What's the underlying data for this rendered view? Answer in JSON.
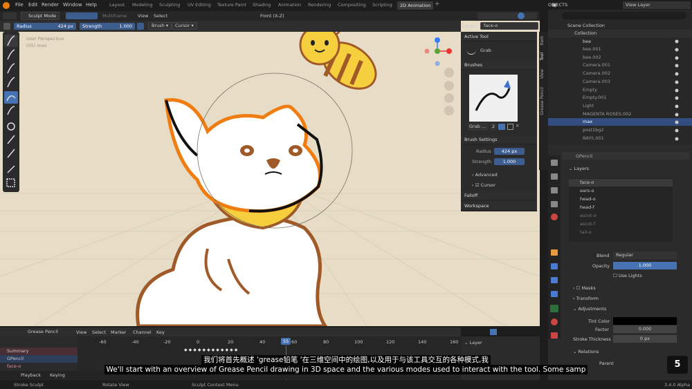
{
  "topbar": {
    "menus": [
      "File",
      "Edit",
      "Render",
      "Window",
      "Help"
    ],
    "mode": "Sculpt Mode",
    "multiframe": "Multiframe",
    "view": "View",
    "select": "Select",
    "workspaces": [
      "Layout",
      "Modeling",
      "Sculpting",
      "UV Editing",
      "Texture Paint",
      "Shading",
      "Animation",
      "Rendering",
      "Compositing",
      "Scripting",
      "2D Animation"
    ],
    "active_workspace": "2D Animation",
    "plus": "+"
  },
  "viewport_header": {
    "orientation": "Front (X-Z)",
    "layer_label": "Layer:",
    "layer_value": "face-o"
  },
  "toolsettings": {
    "radius_label": "Radius",
    "radius_value": "424 px",
    "strength_label": "Strength",
    "strength_value": "1.000",
    "brush": "Brush",
    "cursor": "Cursor"
  },
  "viewport": {
    "line1": "User Perspective",
    "line2": "(55) max"
  },
  "npanel": {
    "active_tool": "Active Tool",
    "tool_name": "Grab",
    "brushes": "Brushes",
    "brush_name": "Grab ...",
    "brush_users": "2",
    "brush_settings": "Brush Settings",
    "radius_label": "Radius",
    "radius_value": "424 px",
    "strength_label": "Strength",
    "strength_value": "1.000",
    "advanced": "Advanced",
    "cursor": "Cursor",
    "falloff": "Falloff",
    "workspace": "Workspace"
  },
  "vtabs": [
    "Item",
    "Tool",
    "View",
    "Grease Pencil"
  ],
  "outliner": {
    "editor": "OBJECTS",
    "view_layer": "View Layer",
    "scene_collection": "Scene Collection",
    "collection": "Collection",
    "rows": [
      "bee",
      "bee.001",
      "bee.002",
      "Camera.001",
      "Camera.002",
      "Camera.003",
      "Empty",
      "Empty.001",
      "Light",
      "MAGENTA ROSES.002",
      "max",
      "post1bg2",
      "RAYS.001"
    ]
  },
  "props": {
    "object": "GPencil",
    "layers_title": "Layers",
    "layers": [
      "face-o",
      "ears-o",
      "head-o",
      "head-f",
      "ascot-o",
      "ascot-f",
      "tail-o"
    ],
    "blend_label": "Blend",
    "blend_value": "Regular",
    "opacity_label": "Opacity",
    "opacity_value": "1.000",
    "use_lights": "Use Lights",
    "masks": "Masks",
    "transform": "Transform",
    "adjustments": "Adjustments",
    "tint_label": "Tint Color",
    "factor_label": "Factor",
    "factor_value": "0.000",
    "stroke_label": "Stroke Thickness",
    "stroke_value": "0 px",
    "relations": "Relations",
    "parent_label": "Parent"
  },
  "timeline": {
    "editor": "Grease Pencil",
    "menus": [
      "View",
      "Select",
      "Marker",
      "Channel",
      "Key"
    ],
    "summary": "Summary",
    "gpencil": "GPencil",
    "layer": "face-o",
    "frames": [
      "-60",
      "-40",
      "-20",
      "0",
      "20",
      "40",
      "60",
      "80",
      "100",
      "120",
      "140",
      "160"
    ],
    "current_frame": "55",
    "playback": "Playback",
    "keying": "Keying",
    "layer_panel": "Layer"
  },
  "status": {
    "left": "Stroke Sculpt",
    "mid": "Rotate View",
    "right": "Sculpt Context Menu",
    "version": "3.4.0 Alpha"
  },
  "subtitles": {
    "cn": "我们将首先概述 'grease铅笔 '在三维空间中的绘图,以及用于与该工具交互的各种模式,我",
    "en": "We'll start with an overview of Grease Pencil drawing in 3D space and the various modes used to interact with the tool. Some samp"
  },
  "badge": "5",
  "colors": {
    "accent": "#4772b3",
    "viewport_bg": "#e7ddc7",
    "outline_orange": "#f07d12",
    "outline_brown": "#a05a28",
    "scarf": "#f5cf3d"
  }
}
